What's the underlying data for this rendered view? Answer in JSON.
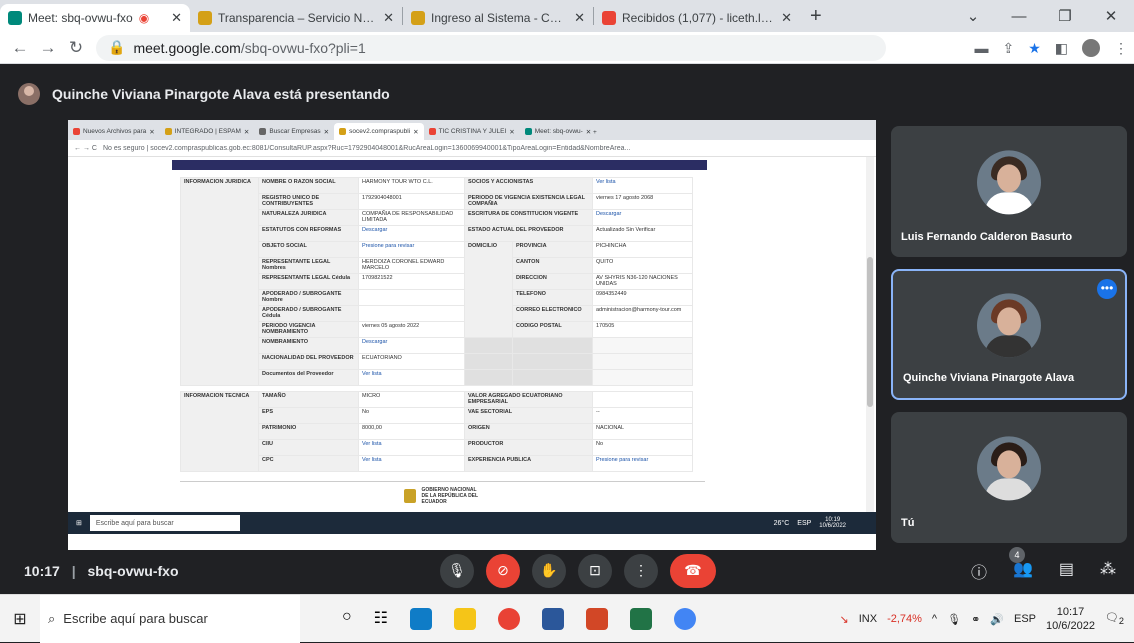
{
  "tabs": [
    {
      "title": "Meet: sbq-ovwu-fxo",
      "color": "#00897b"
    },
    {
      "title": "Transparencia – Servicio Naciona",
      "color": "#d4a017"
    },
    {
      "title": "Ingreso al Sistema - Compras Pú",
      "color": "#d4a017"
    },
    {
      "title": "Recibidos (1,077) - liceth.lopez@",
      "color": "#ea4335"
    }
  ],
  "address": {
    "host": "meet.google.com",
    "path": "/sbq-ovwu-fxo?pli=1"
  },
  "presenter_banner": "Quinche Viviana Pinargote Alava está presentando",
  "shared": {
    "tabs": [
      "Nuevos Archivos para",
      "INTEGRADO | ESPAM",
      "Buscar Empresas",
      "socev2.compraspubli",
      "TIC CRISTINA Y JULEI",
      "Meet: sbq-ovwu-"
    ],
    "url": "No es seguro | socev2.compraspublicas.gob.ec:8081/ConsultaRUP.aspx?Ruc=1792904048001&RucAreaLogin=1360069940001&TipoAreaLogin=Entidad&NombreArea...",
    "juridica": {
      "section": "INFORMACION JURIDICA",
      "r1": [
        "NOMBRE O RAZON SOCIAL",
        "HARMONY TOUR WTO C.L.",
        "SOCIOS Y ACCIONISTAS",
        "Ver lista"
      ],
      "r2": [
        "REGISTRO UNICO DE CONTRIBUYENTES",
        "1792904048001",
        "PERIODO DE VIGENCIA EXISTENCIA LEGAL COMPAÑIA",
        "viernes 17 agosto 2068"
      ],
      "r3": [
        "NATURALEZA JURIDICA",
        "COMPAÑIA DE RESPONSABILIDAD LIMITADA",
        "ESCRITURA DE CONSTITUCION VIGENTE",
        "Descargar"
      ],
      "r4": [
        "ESTATUTOS CON REFORMAS",
        "Descargar",
        "ESTADO ACTUAL DEL PROVEEDOR",
        "Actualizado Sin Verificar"
      ],
      "r5": [
        "OBJETO SOCIAL",
        "Presione para revisar",
        "DOMICILIO",
        "PROVINCIA",
        "PICHINCHA"
      ],
      "r6": [
        "REPRESENTANTE LEGAL Nombres",
        "HERDOIZA CORONEL EDWARD MARCELO",
        "CANTON",
        "QUITO"
      ],
      "r7": [
        "REPRESENTANTE LEGAL Cédula",
        "1709821522",
        "DIRECCION",
        "AV SHYRIS N36-120 NACIONES UNIDAS"
      ],
      "r8": [
        "APODERADO / SUBROGANTE Nombre",
        "",
        "TELEFONO",
        "0984352449"
      ],
      "r9": [
        "APODERADO / SUBROGANTE Cédula",
        "",
        "CORREO ELECTRONICO",
        "administracion@harmony-tour.com"
      ],
      "r10": [
        "PERIODO VIGENCIA NOMBRAMIENTO",
        "viernes 05 agosto 2022",
        "CODIGO POSTAL",
        "170505"
      ],
      "r11": [
        "NOMBRAMIENTO",
        "Descargar"
      ],
      "r12": [
        "NACIONALIDAD DEL PROVEEDOR",
        "ECUATORIANO"
      ],
      "r13": [
        "Documentos del Proveedor",
        "Ver lista"
      ]
    },
    "tecnica": {
      "section": "INFORMACION TECNICA",
      "r1": [
        "TAMAÑO",
        "MICRO",
        "VALOR AGREGADO ECUATORIANO EMPRESARIAL",
        ""
      ],
      "r2": [
        "EPS",
        "No",
        "VAE SECTORIAL",
        "--"
      ],
      "r3": [
        "PATRIMONIO",
        "8000,00",
        "ORIGEN",
        "NACIONAL"
      ],
      "r4": [
        "CIIU",
        "Ver lista",
        "PRODUCTOR",
        "No"
      ],
      "r5": [
        "CPC",
        "Ver lista",
        "EXPERIENCIA PUBLICA",
        "Presione para revisar"
      ]
    },
    "logo_text": "GOBIERNO NACIONAL DE LA REPÚBLICA DEL ECUADOR",
    "taskbar_search": "Escribe aquí para buscar",
    "taskbar_temp": "26°C",
    "taskbar_lang": "ESP",
    "taskbar_time": "10:19",
    "taskbar_date": "10/6/2022"
  },
  "participants": [
    {
      "name": "Luis Fernando Calderon Basurto"
    },
    {
      "name": "Quinche Viviana Pinargote Alava"
    },
    {
      "name": "Tú"
    }
  ],
  "meeting": {
    "time": "10:17",
    "code": "sbq-ovwu-fxo",
    "participant_count": "4"
  },
  "taskbar": {
    "search": "Escribe aquí para buscar",
    "stock_name": "INX",
    "stock_change": "-2,74%",
    "lang": "ESP",
    "time": "10:17",
    "date": "10/6/2022",
    "notif": "2"
  }
}
